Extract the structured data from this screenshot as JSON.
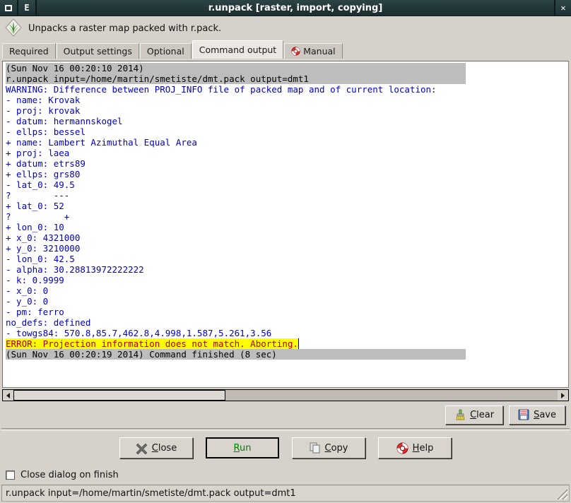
{
  "window": {
    "title": "r.unpack [raster, import, copying]",
    "sys_menu_icon": "window-restore-icon",
    "edit_icon_label": "E",
    "close_glyph": "✕"
  },
  "description": {
    "logo": "grass-gis-logo-icon",
    "text": "Unpacks a raster map packed with r.pack."
  },
  "tabs": [
    {
      "label": "Required",
      "active": false,
      "icon": null
    },
    {
      "label": "Output settings",
      "active": false,
      "icon": null
    },
    {
      "label": "Optional",
      "active": false,
      "icon": null
    },
    {
      "label": "Command output",
      "active": true,
      "icon": null
    },
    {
      "label": "Manual",
      "active": false,
      "icon": "life-ring-icon"
    }
  ],
  "console": {
    "lines": [
      {
        "text": "(Sun Nov 16 00:20:10 2014)",
        "style": "sel"
      },
      {
        "text": "r.unpack input=/home/martin/smetiste/dmt.pack output=dmt1",
        "style": "sel"
      },
      {
        "text": "WARNING: Difference between PROJ_INFO file of packed map and of current location:",
        "style": "plain"
      },
      {
        "text": "- name: Krovak",
        "style": "plain"
      },
      {
        "text": "- proj: krovak",
        "style": "plain"
      },
      {
        "text": "- datum: hermannskogel",
        "style": "plain"
      },
      {
        "text": "- ellps: bessel",
        "style": "plain"
      },
      {
        "text": "+ name: Lambert Azimuthal Equal Area",
        "style": "plain"
      },
      {
        "text": "+ proj: laea",
        "style": "plain"
      },
      {
        "text": "+ datum: etrs89",
        "style": "plain"
      },
      {
        "text": "+ ellps: grs80",
        "style": "plain"
      },
      {
        "text": "- lat_0: 49.5",
        "style": "plain"
      },
      {
        "text": "?        ---",
        "style": "plain"
      },
      {
        "text": "+ lat_0: 52",
        "style": "plain"
      },
      {
        "text": "?          +",
        "style": "plain"
      },
      {
        "text": "+ lon_0: 10",
        "style": "plain"
      },
      {
        "text": "+ x_0: 4321000",
        "style": "plain"
      },
      {
        "text": "+ y_0: 3210000",
        "style": "plain"
      },
      {
        "text": "- lon_0: 42.5",
        "style": "plain"
      },
      {
        "text": "- alpha: 30.28813972222222",
        "style": "plain"
      },
      {
        "text": "- k: 0.9999",
        "style": "plain"
      },
      {
        "text": "- x_0: 0",
        "style": "plain"
      },
      {
        "text": "- y_0: 0",
        "style": "plain"
      },
      {
        "text": "- pm: ferro",
        "style": "plain"
      },
      {
        "text": "no_defs: defined",
        "style": "plain"
      },
      {
        "text": "- towgs84: 570.8,85.7,462.8,4.998,1.587,5.261,3.56",
        "style": "plain"
      },
      {
        "text": "ERROR: Projection information does not match. Aborting.",
        "style": "err"
      },
      {
        "text": "(Sun Nov 16 00:20:19 2014) Command finished (8 sec)",
        "style": "sel"
      }
    ]
  },
  "scrollbar": {
    "left_arrow": "scroll-left-arrow-icon",
    "right_arrow": "scroll-right-arrow-icon",
    "thumb_fraction": "39%"
  },
  "output_actions": [
    {
      "label_pre": "",
      "mnemonic": "C",
      "label_post": "lear",
      "full": "Clear",
      "icon": "broom-icon"
    },
    {
      "label_pre": "",
      "mnemonic": "S",
      "label_post": "ave",
      "full": "Save",
      "icon": "floppy-disk-icon"
    }
  ],
  "main_actions": [
    {
      "label_pre": "",
      "mnemonic": "C",
      "label_post": "lose",
      "full": "Close",
      "icon": "close-x-icon",
      "focused": false
    },
    {
      "label_pre": "",
      "mnemonic": "R",
      "label_post": "un",
      "full": "Run",
      "icon": null,
      "focused": true
    },
    {
      "label_pre": "",
      "mnemonic": "C",
      "label_post": "opy",
      "full": "Copy",
      "icon": "copy-icon",
      "focused": false
    },
    {
      "label_pre": "",
      "mnemonic": "H",
      "label_post": "elp",
      "full": "Help",
      "icon": "life-ring-icon",
      "focused": false
    }
  ],
  "checkbox": {
    "label": "Close dialog on finish",
    "checked": false
  },
  "statusbar": {
    "text": "r.unpack input=/home/martin/smetiste/dmt.pack output=dmt1",
    "grip": "resize-grip-icon"
  },
  "colors": {
    "titlebar": "#24383a",
    "face": "#d6d2cb",
    "console_text": "#0000cc",
    "error_bg": "#ffff00",
    "error_fg": "#b00000",
    "selection_bg": "#bdbdbd",
    "run_label": "#008000"
  }
}
